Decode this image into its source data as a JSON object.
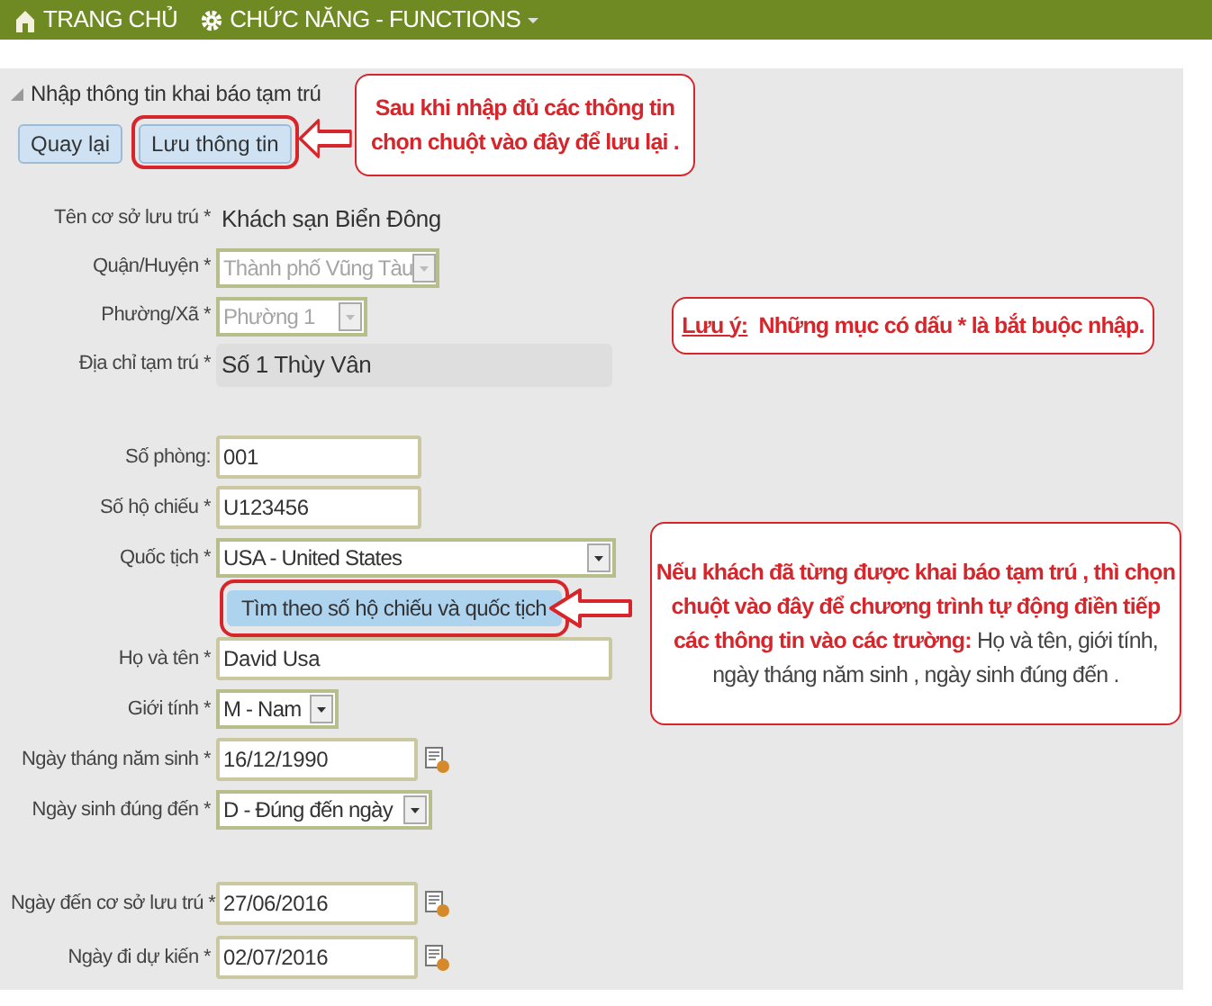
{
  "nav": {
    "items": [
      {
        "label": "TRANG CHỦ",
        "dropdown": false
      },
      {
        "label": "CHỨC NĂNG - FUNCTIONS",
        "dropdown": true
      }
    ]
  },
  "panel": {
    "title": "Nhập thông tin khai báo tạm trú",
    "buttons": [
      {
        "label": "Quay lại",
        "highlighted": false
      },
      {
        "label": "Lưu thông tin",
        "highlighted": true
      }
    ],
    "sections": [
      [
        {
          "kind": "static",
          "label": "Tên cơ sở lưu trú *",
          "value": "Khách sạn Biển Đông"
        },
        {
          "kind": "select",
          "label": "Quận/Huyện *",
          "value": "Thành phố Vũng Tàu",
          "disabled": true
        },
        {
          "kind": "select",
          "label": "Phường/Xã *",
          "value": "Phường 1",
          "disabled": true
        },
        {
          "kind": "readonly",
          "label": "Địa chỉ tạm trú *",
          "value": "Số 1 Thùy Vân"
        }
      ],
      [
        {
          "kind": "input",
          "label": "Số phòng:",
          "value": "001"
        },
        {
          "kind": "input",
          "label": "Số hộ chiếu *",
          "value": "U123456"
        },
        {
          "kind": "select",
          "label": "Quốc tịch *",
          "value": "USA - United States",
          "disabled": false
        },
        {
          "kind": "button",
          "label": "Tìm theo số hộ chiếu và quốc tịch",
          "highlighted": true
        },
        {
          "kind": "input",
          "label": "Họ và tên *",
          "value": "David Usa"
        },
        {
          "kind": "select",
          "label": "Giới tính *",
          "value": "M - Nam",
          "disabled": false
        },
        {
          "kind": "date",
          "label": "Ngày tháng năm sinh *",
          "value": "16/12/1990"
        },
        {
          "kind": "select",
          "label": "Ngày sinh đúng đến *",
          "value": "D - Đúng đến ngày",
          "disabled": false
        }
      ],
      [
        {
          "kind": "date",
          "label": "Ngày đến cơ sở lưu trú *",
          "value": "27/06/2016"
        },
        {
          "kind": "date",
          "label": "Ngày đi dự kiến *",
          "value": "02/07/2016"
        }
      ]
    ]
  },
  "callouts": [
    {
      "kind": "arrow",
      "lines": [
        "Sau khi nhập đủ các thông tin",
        "chọn chuột vào đây để lưu lại ."
      ]
    },
    {
      "kind": "note",
      "label": "Lưu ý:",
      "lines": [
        "Những mục có dấu * là bắt buộc nhập."
      ]
    },
    {
      "kind": "arrow",
      "lines": [
        "Nếu khách đã từng được khai báo tạm trú , thì chọn",
        "chuột vào đây để chương trình tự động điền tiếp",
        "**các thông tin vào các trường:** Họ và tên, giới tính,",
        "ngày tháng năm sinh , ngày sinh đúng đến ."
      ]
    }
  ]
}
